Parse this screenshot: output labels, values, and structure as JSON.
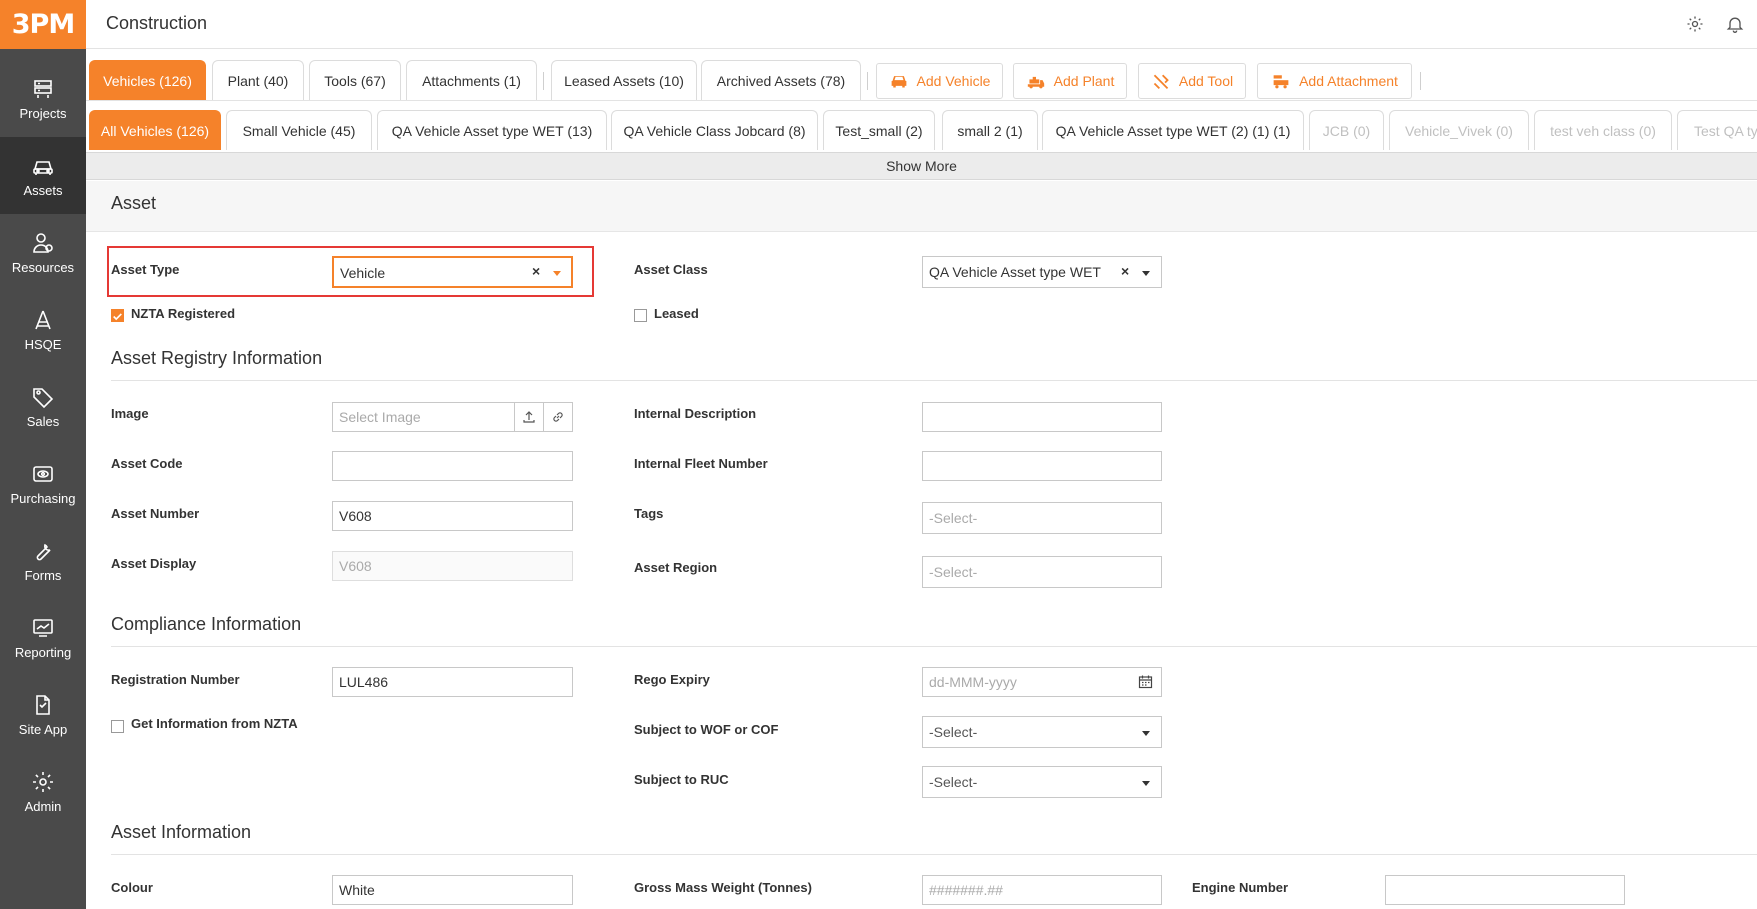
{
  "app": {
    "logo": "3PM",
    "title": "Construction"
  },
  "sidebar": {
    "items": [
      {
        "label": "Projects",
        "icon": "projects-icon"
      },
      {
        "label": "Assets",
        "icon": "assets-icon",
        "active": true
      },
      {
        "label": "Resources",
        "icon": "resources-icon"
      },
      {
        "label": "HSQE",
        "icon": "hsqe-icon"
      },
      {
        "label": "Sales",
        "icon": "sales-icon"
      },
      {
        "label": "Purchasing",
        "icon": "purchasing-icon"
      },
      {
        "label": "Forms",
        "icon": "forms-icon"
      },
      {
        "label": "Reporting",
        "icon": "reporting-icon"
      },
      {
        "label": "Site App",
        "icon": "site-app-icon"
      },
      {
        "label": "Admin",
        "icon": "admin-icon"
      }
    ]
  },
  "category_tabs": [
    {
      "label": "Vehicles (126)",
      "active": true
    },
    {
      "label": "Plant (40)"
    },
    {
      "label": "Tools (67)"
    },
    {
      "label": "Attachments (1)"
    },
    {
      "label": "Leased Assets (10)"
    },
    {
      "label": "Archived Assets (78)"
    }
  ],
  "actions": [
    {
      "label": "Add Vehicle",
      "icon": "vehicle-icon"
    },
    {
      "label": "Add Plant",
      "icon": "plant-icon"
    },
    {
      "label": "Add Tool",
      "icon": "tool-icon"
    },
    {
      "label": "Add Attachment",
      "icon": "attachment-icon"
    }
  ],
  "class_tabs": [
    {
      "label": "All Vehicles (126)",
      "active": true
    },
    {
      "label": "Small Vehicle (45)"
    },
    {
      "label": "QA Vehicle Asset type WET (13)"
    },
    {
      "label": "QA Vehicle Class Jobcard (8)"
    },
    {
      "label": "Test_small (2)"
    },
    {
      "label": "small 2 (1)"
    },
    {
      "label": "QA Vehicle Asset type WET (2) (1) (1)"
    },
    {
      "label": "JCB (0)",
      "disabled": true
    },
    {
      "label": "Vehicle_Vivek (0)",
      "disabled": true
    },
    {
      "label": "test veh class (0)",
      "disabled": true
    },
    {
      "label": "Test QA typ",
      "disabled": true
    }
  ],
  "show_more": "Show More",
  "asset": {
    "title": "Asset",
    "asset_type_label": "Asset Type",
    "asset_type_value": "Vehicle",
    "asset_class_label": "Asset Class",
    "asset_class_value": "QA Vehicle Asset type WET",
    "nzta_label": "NZTA Registered",
    "nzta_checked": true,
    "leased_label": "Leased",
    "leased_checked": false
  },
  "registry": {
    "title": "Asset Registry Information",
    "image_label": "Image",
    "image_placeholder": "Select Image",
    "asset_code_label": "Asset Code",
    "asset_code_value": "",
    "asset_number_label": "Asset Number",
    "asset_number_value": "V608",
    "asset_display_label": "Asset Display",
    "asset_display_value": "V608",
    "internal_desc_label": "Internal Description",
    "internal_desc_value": "",
    "internal_fleet_label": "Internal Fleet Number",
    "internal_fleet_value": "",
    "tags_label": "Tags",
    "tags_placeholder": "-Select-",
    "region_label": "Asset Region",
    "region_placeholder": "-Select-"
  },
  "compliance": {
    "title": "Compliance Information",
    "reg_number_label": "Registration Number",
    "reg_number_value": "LUL486",
    "get_nzta_label": "Get Information from NZTA",
    "get_nzta_checked": false,
    "rego_expiry_label": "Rego Expiry",
    "rego_expiry_placeholder": "dd-MMM-yyyy",
    "wof_label": "Subject to WOF or COF",
    "wof_value": "-Select-",
    "ruc_label": "Subject to RUC",
    "ruc_value": "-Select-"
  },
  "asset_info": {
    "title": "Asset Information",
    "colour_label": "Colour",
    "colour_value": "White",
    "gmw_label": "Gross Mass Weight (Tonnes)",
    "gmw_placeholder": "#######.##",
    "engine_label": "Engine Number",
    "engine_value": ""
  },
  "colors": {
    "accent": "#f5822a",
    "sidebar": "#4a4a4a",
    "highlight": "#e53935"
  }
}
